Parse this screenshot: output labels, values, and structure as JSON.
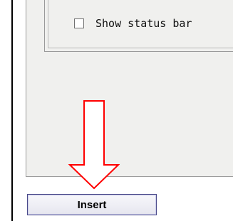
{
  "options": {
    "show_status_bar": {
      "label": "Show status bar",
      "checked": false
    }
  },
  "actions": {
    "insert_label": "Insert"
  },
  "annotation": {
    "arrow_color": "#ff0000",
    "arrow_direction": "down"
  }
}
